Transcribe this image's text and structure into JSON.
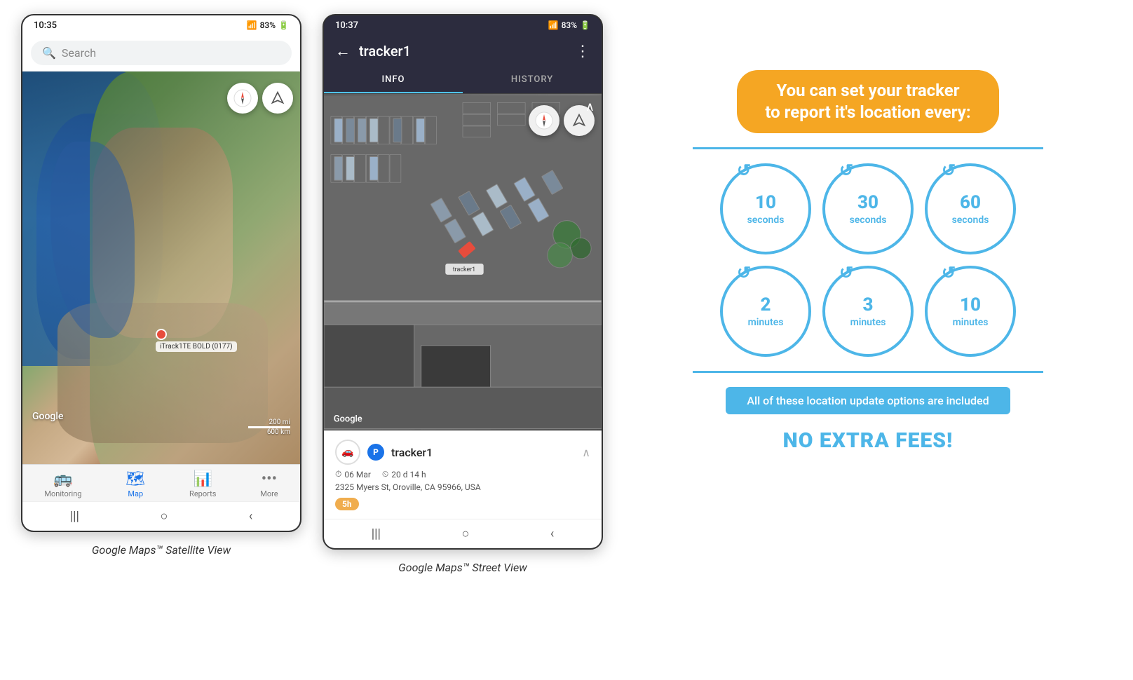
{
  "phone1": {
    "status_time": "10:35",
    "status_signal": "📶",
    "status_battery": "83%",
    "search_placeholder": "Search",
    "google_watermark": "Google",
    "scale_200mi": "200 mi",
    "scale_600km": "600 km",
    "tracker_label": "iTrack1TE BOLD (0177)",
    "nav_items": [
      {
        "label": "Monitoring",
        "icon": "🚌",
        "active": false
      },
      {
        "label": "Map",
        "icon": "📍",
        "active": true
      },
      {
        "label": "Reports",
        "icon": "⊞",
        "active": false
      },
      {
        "label": "More",
        "icon": "•••",
        "active": false
      }
    ],
    "caption": "Google Maps™ Satellite View"
  },
  "phone2": {
    "status_time": "10:37",
    "status_battery": "83%",
    "header_title": "tracker1",
    "tab_info": "INFO",
    "tab_history": "HISTORY",
    "tracker_name": "tracker1",
    "date": "06 Mar",
    "duration": "20 d 14 h",
    "address": "2325 Myers St, Oroville, CA 95966, USA",
    "time_ago": "5h",
    "google_watermark": "Google",
    "tracker_label_map": "tracker1",
    "caption": "Google Maps™ Street View"
  },
  "info": {
    "title": "You can set your tracker\nto report it's location every:",
    "circles": [
      {
        "value": "10",
        "unit": "seconds"
      },
      {
        "value": "30",
        "unit": "seconds"
      },
      {
        "value": "60",
        "unit": "seconds"
      },
      {
        "value": "2",
        "unit": "minutes"
      },
      {
        "value": "3",
        "unit": "minutes"
      },
      {
        "value": "10",
        "unit": "minutes"
      }
    ],
    "bottom_banner": "All of these location update options are included",
    "no_fee": "NO EXTRA FEES!"
  }
}
